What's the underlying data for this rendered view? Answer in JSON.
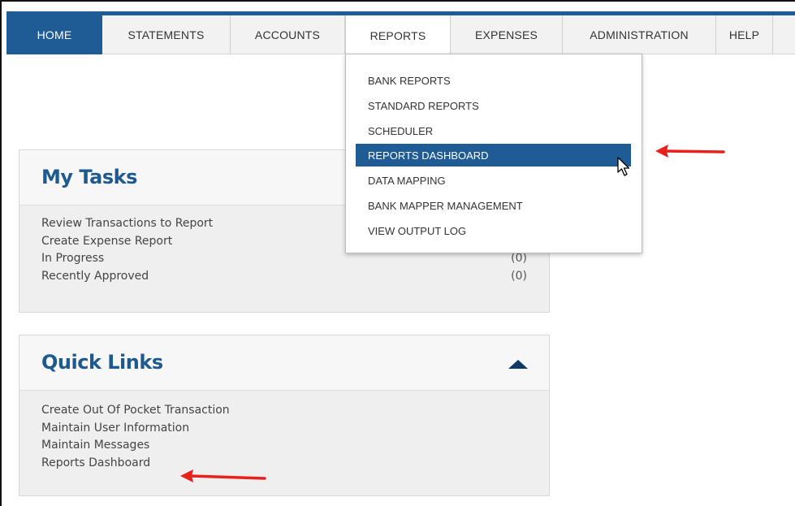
{
  "nav": {
    "items": [
      {
        "label": "HOME",
        "state": "active"
      },
      {
        "label": "STATEMENTS",
        "state": ""
      },
      {
        "label": "ACCOUNTS",
        "state": ""
      },
      {
        "label": "REPORTS",
        "state": "open"
      },
      {
        "label": "EXPENSES",
        "state": ""
      },
      {
        "label": "ADMINISTRATION",
        "state": ""
      },
      {
        "label": "HELP",
        "state": ""
      }
    ]
  },
  "reports_menu": {
    "items": [
      {
        "label": "BANK REPORTS"
      },
      {
        "label": "STANDARD REPORTS"
      },
      {
        "label": "SCHEDULER"
      },
      {
        "label": "REPORTS DASHBOARD",
        "highlighted": true
      },
      {
        "label": "DATA MAPPING"
      },
      {
        "label": "BANK MAPPER MANAGEMENT"
      },
      {
        "label": "VIEW OUTPUT LOG"
      }
    ]
  },
  "my_tasks": {
    "title": "My Tasks",
    "items": [
      {
        "label": "Review Transactions to Report",
        "count": ""
      },
      {
        "label": "Create Expense Report",
        "count": ""
      },
      {
        "label": "In Progress",
        "count": "(0)"
      },
      {
        "label": "Recently Approved",
        "count": "(0)"
      }
    ]
  },
  "quick_links": {
    "title": "Quick Links",
    "items": [
      {
        "label": "Create Out Of Pocket Transaction"
      },
      {
        "label": "Maintain User Information"
      },
      {
        "label": "Maintain Messages"
      },
      {
        "label": "Reports Dashboard"
      }
    ]
  },
  "colors": {
    "nav_accent": "#1f5c96",
    "title_blue": "#1e5a8f",
    "annotation_arrow": "#e8211d"
  },
  "icons": {
    "collapse": "triangle-up-icon",
    "cursor": "mouse-pointer-icon",
    "annotation": "red-arrow-icon"
  }
}
